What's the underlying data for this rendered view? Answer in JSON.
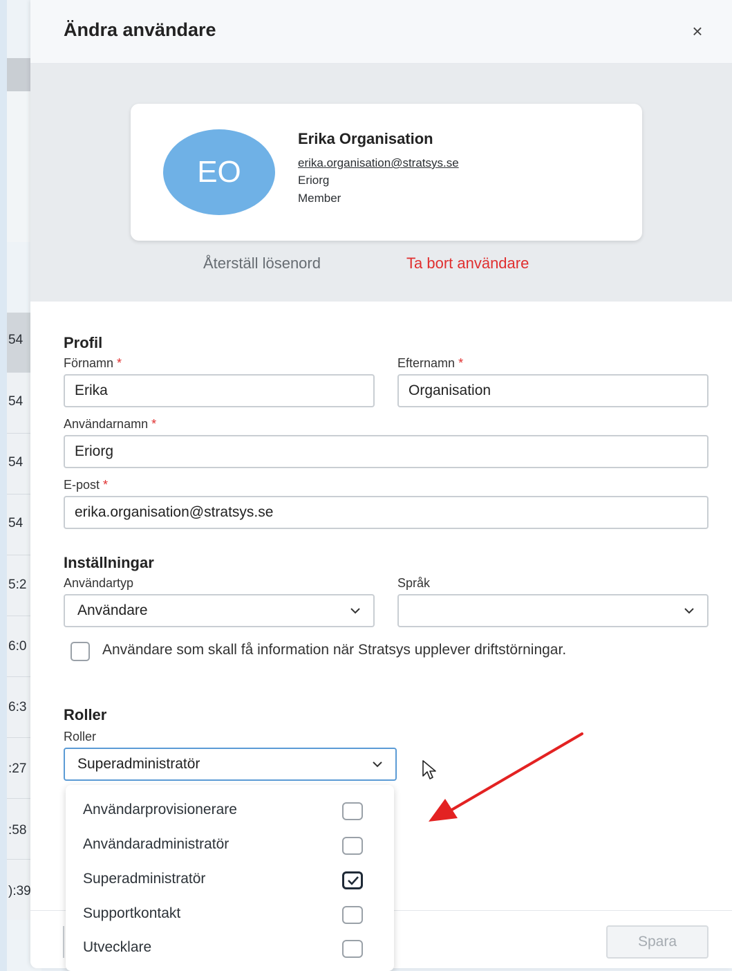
{
  "background": {
    "rows": [
      "54",
      "54",
      "54",
      "54",
      "5:2",
      "6:0",
      "6:3",
      ":27",
      ":58",
      "):39"
    ]
  },
  "modal": {
    "title": "Ändra användare",
    "close_icon": "close-icon",
    "user_card": {
      "initials": "EO",
      "name": "Erika Organisation",
      "email": "erika.organisation@stratsys.se",
      "username": "Eriorg",
      "type": "Member"
    },
    "reset_password": "Återställ lösenord",
    "delete_user": "Ta bort användare",
    "profile": {
      "title": "Profil",
      "firstname_label": "Förnamn",
      "firstname_value": "Erika",
      "lastname_label": "Efternamn",
      "lastname_value": "Organisation",
      "username_label": "Användarnamn",
      "username_value": "Eriorg",
      "email_label": "E-post",
      "email_value": "erika.organisation@stratsys.se",
      "required_mark": "*"
    },
    "settings": {
      "title": "Inställningar",
      "usertype_label": "Användartyp",
      "usertype_value": "Användare",
      "language_label": "Språk",
      "language_value": "",
      "notify_label": "Användare som skall få information när Stratsys upplever driftstörningar.",
      "notify_checked": false
    },
    "roles": {
      "title": "Roller",
      "label": "Roller",
      "value": "Superadministratör",
      "options": [
        {
          "label": "Användarprovisionerare",
          "checked": false
        },
        {
          "label": "Användaradministratör",
          "checked": false
        },
        {
          "label": "Superadministratör",
          "checked": true
        },
        {
          "label": "Supportkontakt",
          "checked": false
        },
        {
          "label": "Utvecklare",
          "checked": false
        }
      ]
    },
    "footer": {
      "save_label": "Spara"
    }
  },
  "annotation": {
    "arrow_color": "#e32222"
  }
}
